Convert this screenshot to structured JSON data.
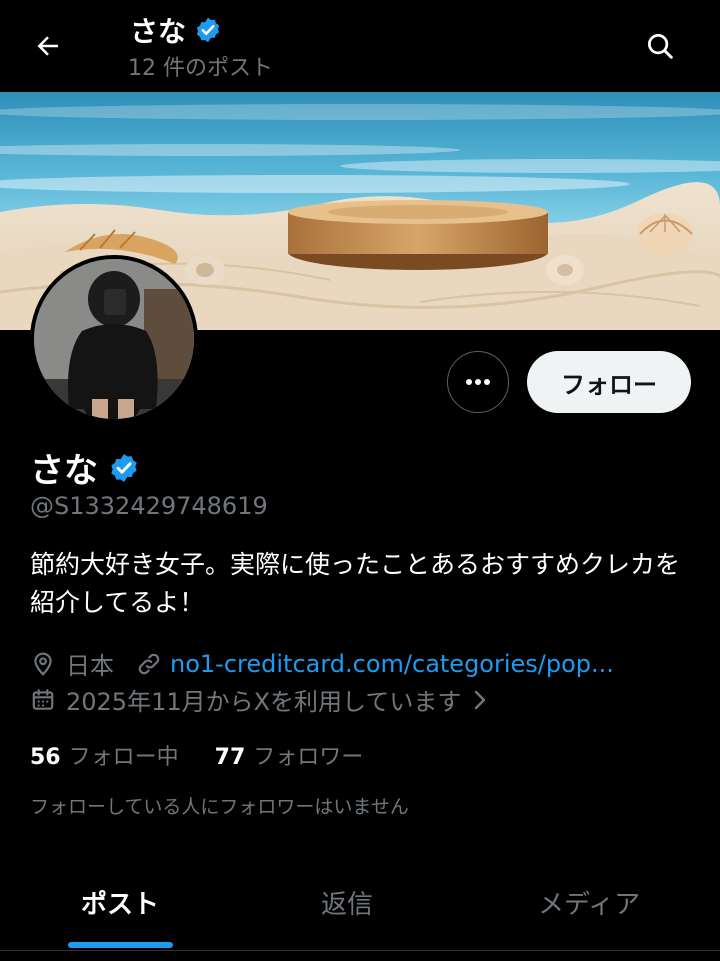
{
  "header": {
    "name": "さな",
    "post_count": "12 件のポスト",
    "back_icon": "arrow-left-icon",
    "search_icon": "search-icon"
  },
  "profile": {
    "display_name": "さな",
    "verified": true,
    "handle": "@S1332429748619",
    "bio": "節約大好き女子。実際に使ったことあるおすすめクレカを紹介してるよ！",
    "location": "日本",
    "website": "no1-creditcard.com/categories/pop...",
    "joined": "2025年11月からXを利用しています",
    "following_count": "56",
    "following_label": "フォロー中",
    "followers_count": "77",
    "followers_label": "フォロワー",
    "mutual_note": "フォローしている人にフォロワーはいません"
  },
  "actions": {
    "follow_label": "フォロー",
    "more_icon": "more-horizontal-icon"
  },
  "tabs": [
    {
      "label": "ポスト",
      "active": true
    },
    {
      "label": "返信",
      "active": false
    },
    {
      "label": "メディア",
      "active": false
    }
  ],
  "colors": {
    "background": "#000000",
    "accent": "#1d9bf0",
    "muted": "#71767b",
    "follow_button": "#eff3f4"
  }
}
